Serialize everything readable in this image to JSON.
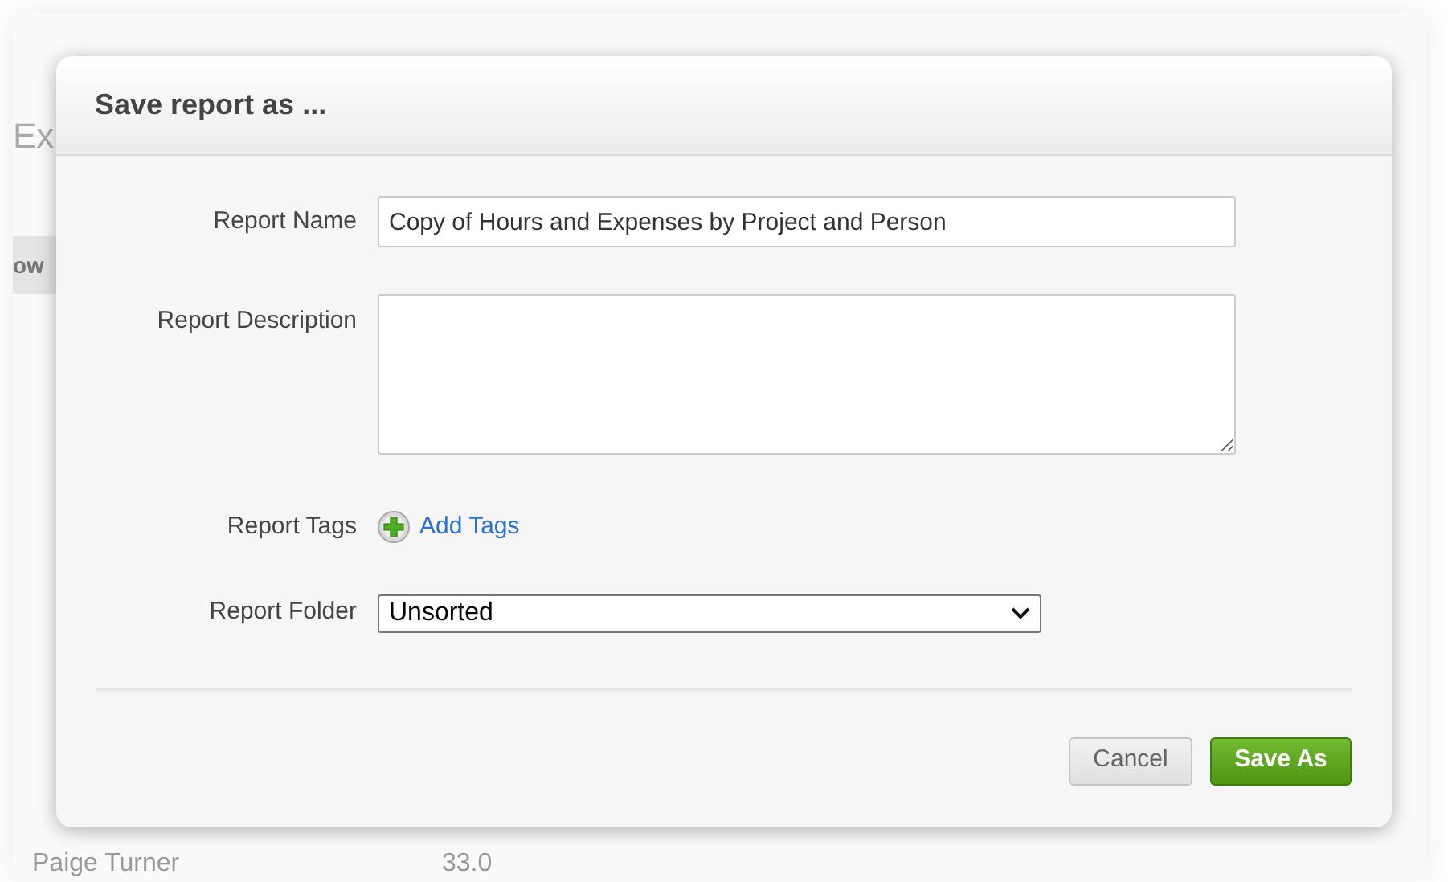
{
  "background": {
    "heading": "Ex",
    "bar_label": "ow",
    "row": {
      "name": "Paige Turner",
      "value": "33.0"
    }
  },
  "dialog": {
    "title": "Save report as ...",
    "fields": [
      {
        "kind": "text",
        "label": "Report Name",
        "value": "Copy of Hours and Expenses by Project and Person"
      },
      {
        "kind": "textarea",
        "label": "Report Description"
      },
      {
        "kind": "tags",
        "label": "Report Tags",
        "link": "Add Tags"
      },
      {
        "kind": "select",
        "label": "Report Folder",
        "value": "Unsorted"
      }
    ],
    "buttons": [
      {
        "kind": "secondary",
        "label": "Cancel"
      },
      {
        "kind": "primary",
        "label": "Save As"
      }
    ]
  }
}
